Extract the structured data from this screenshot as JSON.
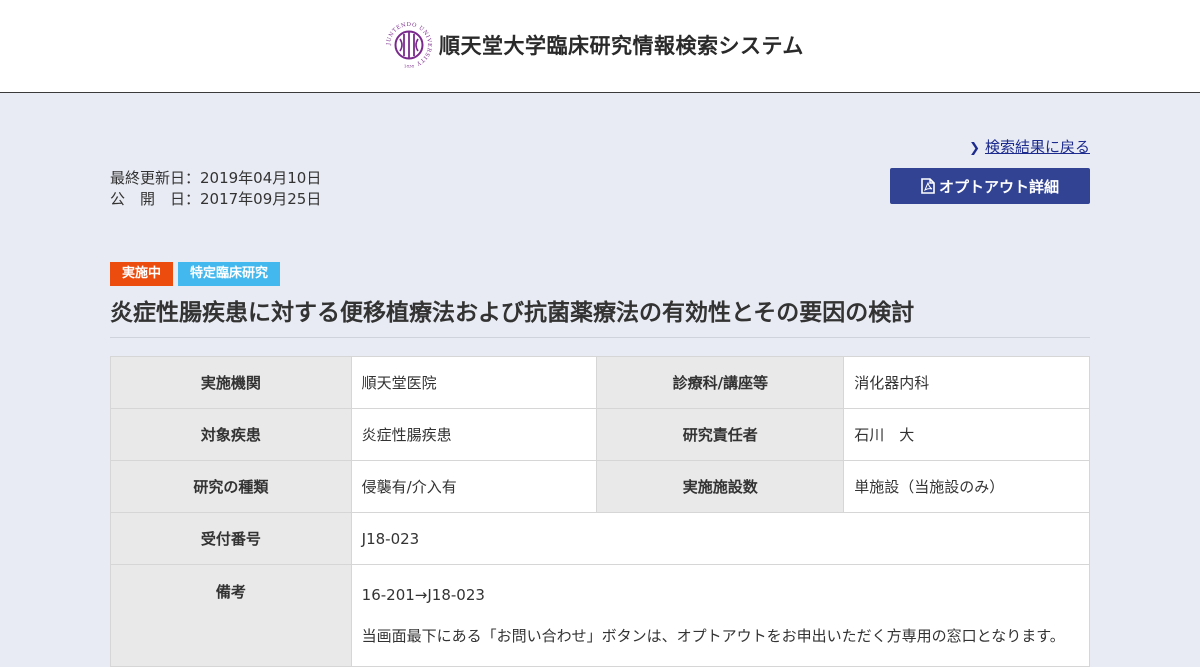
{
  "header": {
    "site_title": "順天堂大学臨床研究情報検索システム",
    "logo": {
      "icon": "juntendo-university-seal",
      "ring_text": "JUNTENDO UNIVERSITY",
      "year": "1838",
      "color": "#7a2a8c"
    }
  },
  "nav": {
    "back_link": "検索結果に戻る"
  },
  "dates": {
    "updated": "最終更新日：2019年04月10日",
    "published": "公　開　日：2017年09月25日"
  },
  "optout_button": {
    "label": "オプトアウト詳細",
    "icon": "pdf-file-icon"
  },
  "badges": {
    "status": "実施中",
    "type": "特定臨床研究"
  },
  "study_title": "炎症性腸疾患に対する便移植療法および抗菌薬療法の有効性とその要因の検討",
  "details": {
    "institution_label": "実施機関",
    "institution": "順天堂医院",
    "department_label": "診療科/講座等",
    "department": "消化器内科",
    "disease_label": "対象疾患",
    "disease": "炎症性腸疾患",
    "pi_label": "研究責任者",
    "pi": "石川　大",
    "study_type_label": "研究の種類",
    "study_type": "侵襲有/介入有",
    "sites_label": "実施施設数",
    "sites": "単施設（当施設のみ）",
    "reception_no_label": "受付番号",
    "reception_no": "J18-023",
    "remarks_label": "備考",
    "remarks_line1": "16-201→J18-023",
    "remarks_line2": "当画面最下にある「お問い合わせ」ボタンは、オプトアウトをお申出いただく方専用の窓口となります。"
  },
  "colors": {
    "page_bg": "#e8ebf3",
    "primary_button": "#324394",
    "status_badge": "#ec4d0f",
    "type_badge": "#42b8ee",
    "link": "#1d2b8e"
  }
}
